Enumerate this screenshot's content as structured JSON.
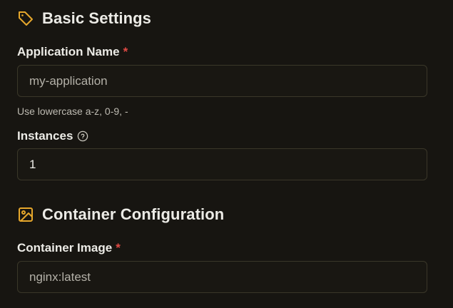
{
  "basic_settings": {
    "title": "Basic Settings",
    "icon": "tag-icon",
    "app_name": {
      "label": "Application Name",
      "required_mark": "*",
      "value": "my-application",
      "hint": "Use lowercase a-z, 0-9, -"
    },
    "instances": {
      "label": "Instances",
      "help_icon": "help-circle-icon",
      "value": "1"
    }
  },
  "container_config": {
    "title": "Container Configuration",
    "icon": "image-icon",
    "image": {
      "label": "Container Image",
      "required_mark": "*",
      "value": "nginx:latest"
    }
  },
  "colors": {
    "background": "#171511",
    "accent": "#e6a72c",
    "required": "#e04a44",
    "border": "#3a3729"
  }
}
